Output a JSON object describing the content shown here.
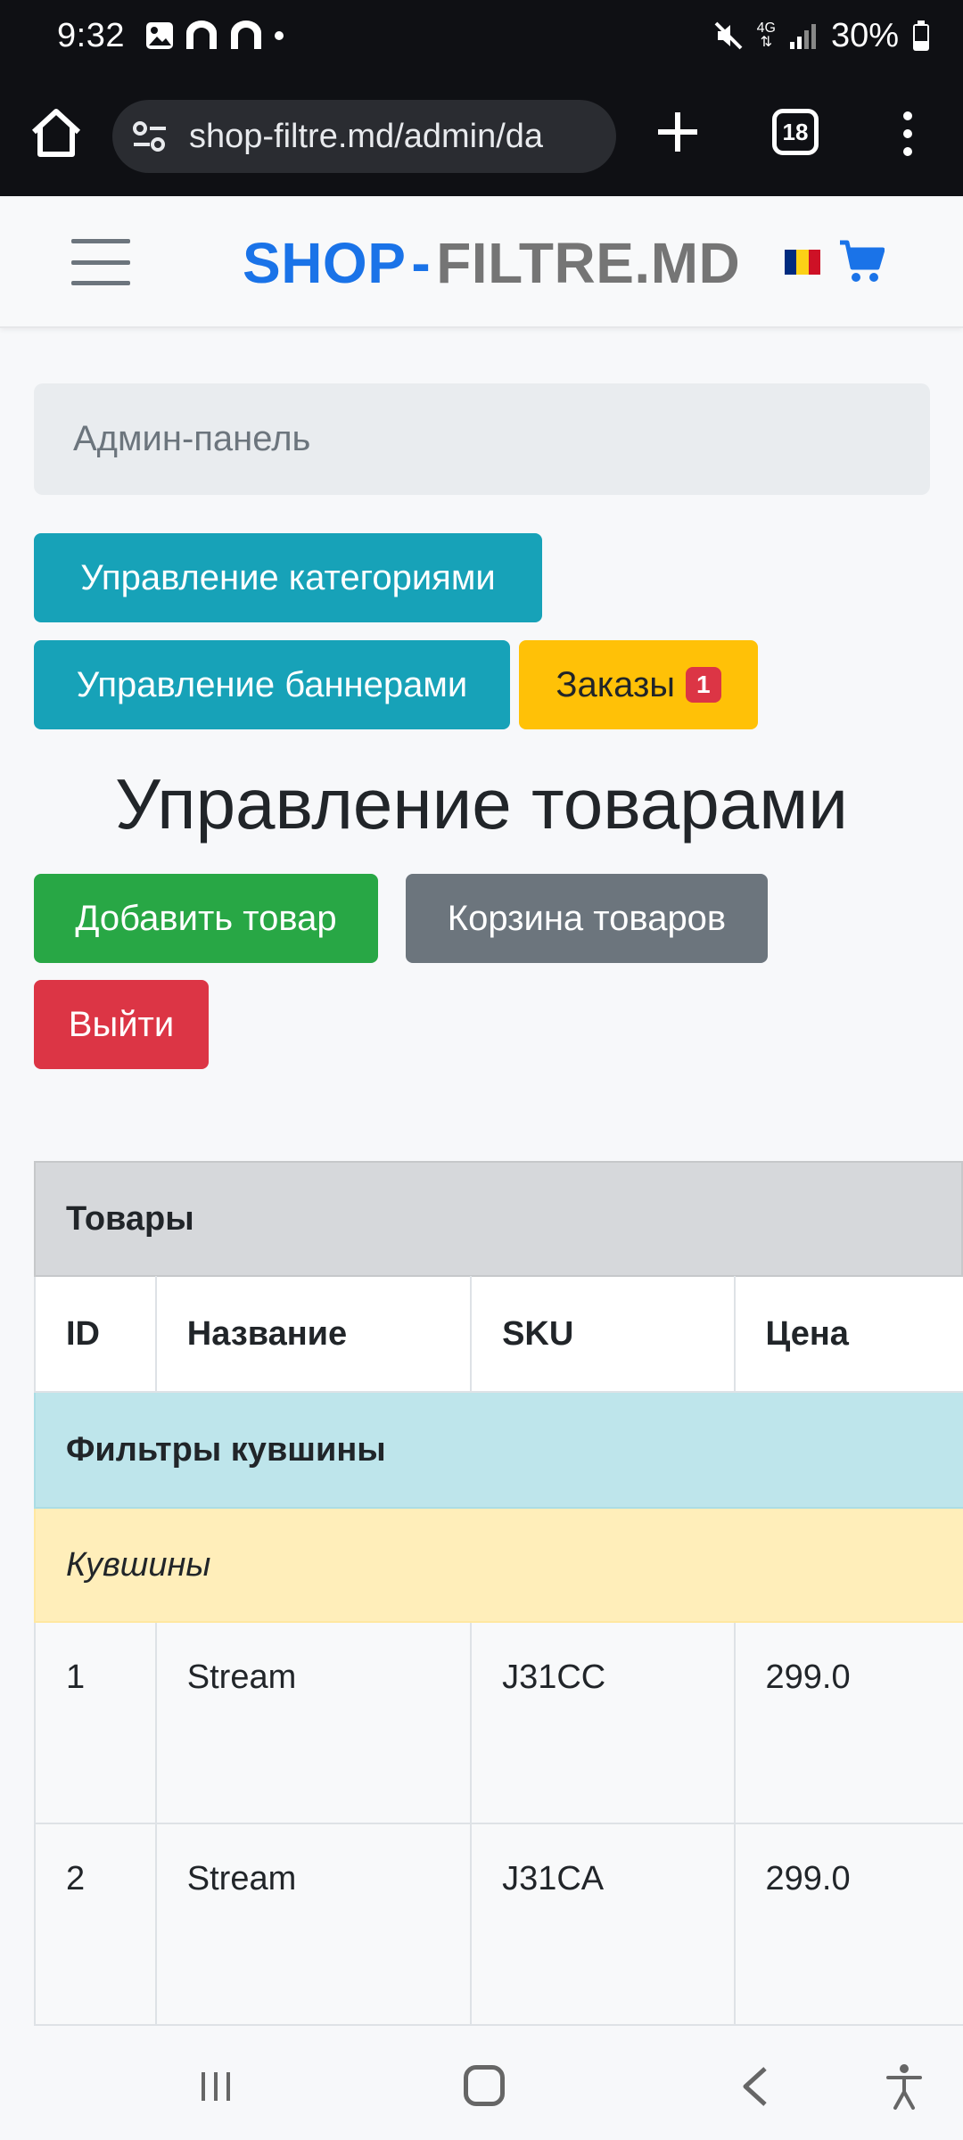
{
  "status_bar": {
    "time": "9:32",
    "battery": "30%",
    "network": "4G"
  },
  "browser": {
    "url": "shop-filtre.md/admin/da",
    "tab_count": "18"
  },
  "header": {
    "brand_part1": "SHOP",
    "brand_sep": "-",
    "brand_part2": "FILTRE.MD"
  },
  "admin": {
    "panel_label": "Админ-панель",
    "manage_categories": "Управление категориями",
    "manage_banners": "Управление баннерами",
    "orders": "Заказы",
    "orders_badge": "1",
    "title": "Управление товарами",
    "add_product": "Добавить товар",
    "product_trash": "Корзина товаров",
    "logout": "Выйти"
  },
  "table": {
    "caption": "Товары",
    "columns": [
      "ID",
      "Название",
      "SKU",
      "Цена"
    ],
    "group": "Фильтры кувшины",
    "subgroup": "Кувшины",
    "rows": [
      {
        "id": "1",
        "name": "Stream",
        "sku": "J31CC",
        "price": "299.0"
      },
      {
        "id": "2",
        "name": "Stream",
        "sku": "J31CA",
        "price": "299.0"
      }
    ]
  },
  "colors": {
    "primary": "#1a73e8",
    "info": "#17a2b8",
    "warning": "#ffc107",
    "success": "#28a745",
    "secondary": "#6c757d",
    "danger": "#dc3545"
  }
}
